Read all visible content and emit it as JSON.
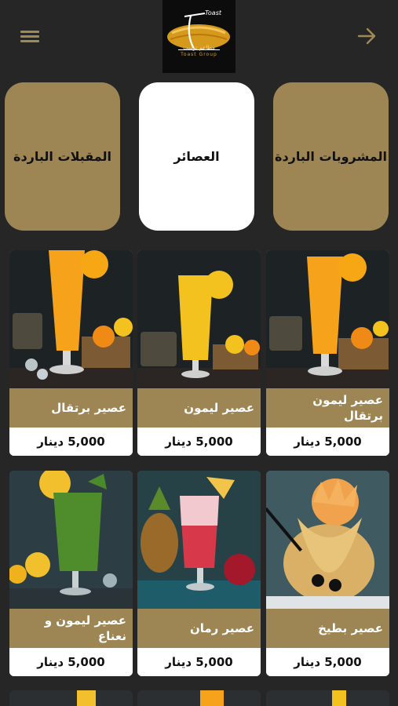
{
  "header": {
    "menu_icon": "hamburger-menu-icon",
    "back_icon": "arrow-right-icon",
    "logo": {
      "word": "Toast",
      "arabic": "مطاعم توست",
      "group": "Toast Group"
    }
  },
  "categories": [
    {
      "label": "المقبلات الباردة",
      "active": false
    },
    {
      "label": "العصائر",
      "active": true
    },
    {
      "label": "المشروبات الباردة",
      "active": false
    }
  ],
  "products": [
    {
      "name": "عصير برتقال",
      "price": "5,000 دينار",
      "juice_color": "#f6a21a"
    },
    {
      "name": "عصير ليمون",
      "price": "5,000 دينار",
      "juice_color": "#f4c21e"
    },
    {
      "name": "عصير ليمون برتقال",
      "price": "5,000 دينار",
      "juice_color": "#f6a21a"
    },
    {
      "name": "عصير ليمون و نعناع",
      "price": "5,000 دينار",
      "juice_color": "#4f8d2c"
    },
    {
      "name": "عصير رمان",
      "price": "5,000 دينار",
      "juice_color": "#d8394a"
    },
    {
      "name": "عصير بطيخ",
      "price": "5,000 دينار",
      "juice_color": "#f1a24c"
    }
  ],
  "colors": {
    "accent": "#9d8554",
    "background": "#262626",
    "card": "#ffffff"
  }
}
